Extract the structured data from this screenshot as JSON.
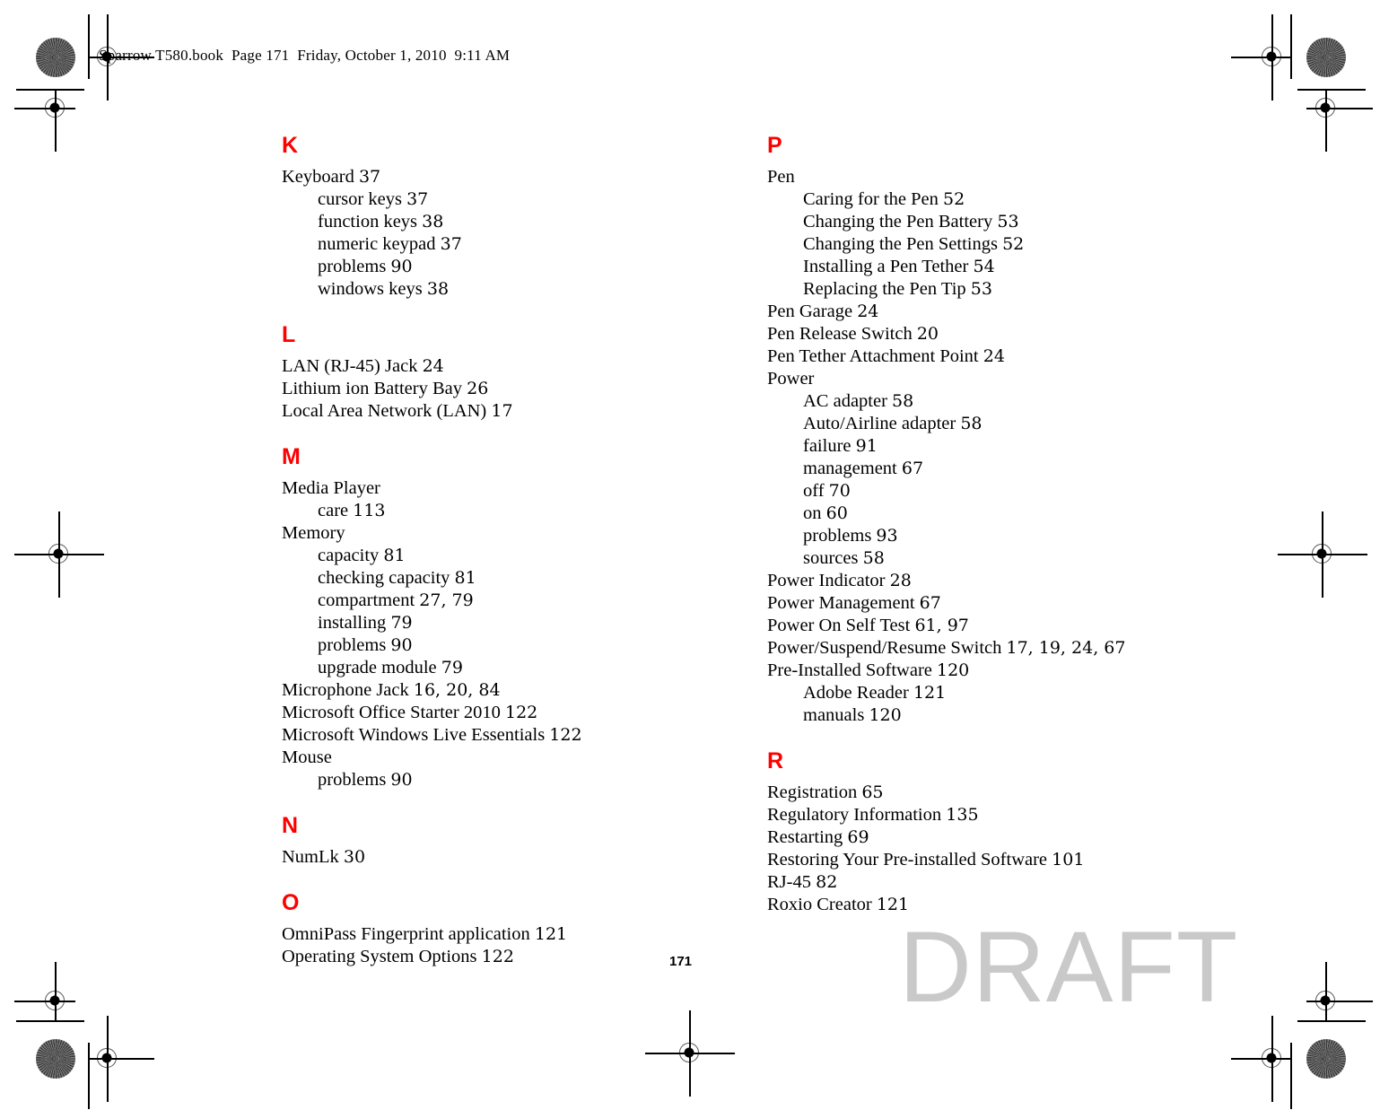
{
  "header": {
    "file_line": "Sparrow T580.book  Page 171  Friday, October 1, 2010  9:11 AM"
  },
  "footer": {
    "page_number": "171",
    "watermark": "DRAFT"
  },
  "colors": {
    "letter_heading": "#ff0000",
    "watermark": "#c9c9c9",
    "body_text": "#000000",
    "page_background": "#ffffff"
  },
  "index": {
    "left_column": [
      {
        "letter": "K",
        "entries": [
          {
            "level": 0,
            "text": "Keyboard",
            "pages": "37"
          },
          {
            "level": 1,
            "text": "cursor keys",
            "pages": "37"
          },
          {
            "level": 1,
            "text": "function keys",
            "pages": "38"
          },
          {
            "level": 1,
            "text": "numeric keypad",
            "pages": "37"
          },
          {
            "level": 1,
            "text": "problems",
            "pages": "90"
          },
          {
            "level": 1,
            "text": "windows keys",
            "pages": "38"
          }
        ]
      },
      {
        "letter": "L",
        "entries": [
          {
            "level": 0,
            "text": "LAN (RJ-45) Jack",
            "pages": "24"
          },
          {
            "level": 0,
            "text": "Lithium ion Battery Bay",
            "pages": "26"
          },
          {
            "level": 0,
            "text": "Local Area Network (LAN)",
            "pages": "17"
          }
        ]
      },
      {
        "letter": "M",
        "entries": [
          {
            "level": 0,
            "text": "Media Player",
            "pages": ""
          },
          {
            "level": 1,
            "text": "care",
            "pages": "113"
          },
          {
            "level": 0,
            "text": "Memory",
            "pages": ""
          },
          {
            "level": 1,
            "text": "capacity",
            "pages": "81"
          },
          {
            "level": 1,
            "text": "checking capacity",
            "pages": "81"
          },
          {
            "level": 1,
            "text": "compartment",
            "pages": "27, 79"
          },
          {
            "level": 1,
            "text": "installing",
            "pages": "79"
          },
          {
            "level": 1,
            "text": "problems",
            "pages": "90"
          },
          {
            "level": 1,
            "text": "upgrade module",
            "pages": "79"
          },
          {
            "level": 0,
            "text": "Microphone Jack",
            "pages": "16, 20, 84"
          },
          {
            "level": 0,
            "text": "Microsoft Office Starter 2010",
            "pages": "122"
          },
          {
            "level": 0,
            "text": "Microsoft Windows Live Essentials",
            "pages": "122"
          },
          {
            "level": 0,
            "text": "Mouse",
            "pages": ""
          },
          {
            "level": 1,
            "text": "problems",
            "pages": "90"
          }
        ]
      },
      {
        "letter": "N",
        "entries": [
          {
            "level": 0,
            "text": "NumLk",
            "pages": "30"
          }
        ]
      },
      {
        "letter": "O",
        "entries": [
          {
            "level": 0,
            "text": "OmniPass Fingerprint application",
            "pages": "121"
          },
          {
            "level": 0,
            "text": "Operating System Options",
            "pages": "122"
          }
        ]
      }
    ],
    "right_column": [
      {
        "letter": "P",
        "entries": [
          {
            "level": 0,
            "text": "Pen",
            "pages": ""
          },
          {
            "level": 1,
            "text": "Caring for the Pen",
            "pages": "52"
          },
          {
            "level": 1,
            "text": "Changing the Pen Battery",
            "pages": "53"
          },
          {
            "level": 1,
            "text": "Changing the Pen Settings",
            "pages": "52"
          },
          {
            "level": 1,
            "text": "Installing a Pen Tether",
            "pages": "54"
          },
          {
            "level": 1,
            "text": "Replacing the Pen Tip",
            "pages": "53"
          },
          {
            "level": 0,
            "text": "Pen Garage",
            "pages": "24"
          },
          {
            "level": 0,
            "text": "Pen Release Switch",
            "pages": "20"
          },
          {
            "level": 0,
            "text": "Pen Tether Attachment Point",
            "pages": "24"
          },
          {
            "level": 0,
            "text": "Power",
            "pages": ""
          },
          {
            "level": 1,
            "text": "AC adapter",
            "pages": "58"
          },
          {
            "level": 1,
            "text": "Auto/Airline adapter",
            "pages": "58"
          },
          {
            "level": 1,
            "text": "failure",
            "pages": "91"
          },
          {
            "level": 1,
            "text": "management",
            "pages": "67"
          },
          {
            "level": 1,
            "text": "off",
            "pages": "70"
          },
          {
            "level": 1,
            "text": "on",
            "pages": "60"
          },
          {
            "level": 1,
            "text": "problems",
            "pages": "93"
          },
          {
            "level": 1,
            "text": "sources",
            "pages": "58"
          },
          {
            "level": 0,
            "text": "Power Indicator",
            "pages": "28"
          },
          {
            "level": 0,
            "text": "Power Management",
            "pages": "67"
          },
          {
            "level": 0,
            "text": "Power On Self Test",
            "pages": "61, 97"
          },
          {
            "level": 0,
            "text": "Power/Suspend/Resume Switch",
            "pages": "17, 19, 24, 67"
          },
          {
            "level": 0,
            "text": "Pre-Installed Software",
            "pages": "120"
          },
          {
            "level": 1,
            "text": "Adobe Reader",
            "pages": "121"
          },
          {
            "level": 1,
            "text": "manuals",
            "pages": "120"
          }
        ]
      },
      {
        "letter": "R",
        "entries": [
          {
            "level": 0,
            "text": "Registration",
            "pages": "65"
          },
          {
            "level": 0,
            "text": "Regulatory Information",
            "pages": "135"
          },
          {
            "level": 0,
            "text": "Restarting",
            "pages": "69"
          },
          {
            "level": 0,
            "text": "Restoring Your Pre-installed Software",
            "pages": "101"
          },
          {
            "level": 0,
            "text": "RJ-45",
            "pages": "82"
          },
          {
            "level": 0,
            "text": "Roxio Creator",
            "pages": "121"
          }
        ]
      }
    ]
  },
  "print_marks": {
    "registration_mark_name": "registration-crosshair-mark",
    "rosette_name": "color-rosette-mark",
    "crop_line_name": "crop-mark-line"
  }
}
